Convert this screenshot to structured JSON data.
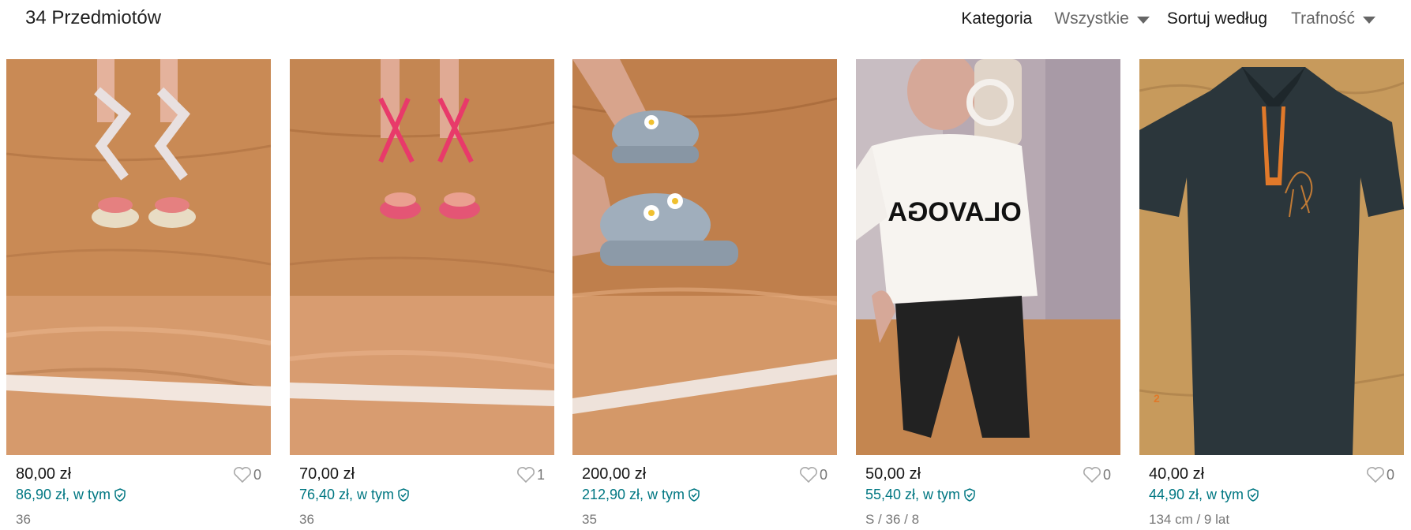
{
  "header": {
    "item_count": "34 Przedmiotów",
    "category_label": "Kategoria",
    "category_value": "Wszystkie",
    "sort_label": "Sortuj według",
    "sort_value": "Trafność"
  },
  "colors": {
    "accent": "#007782",
    "muted": "#777777"
  },
  "items": [
    {
      "price": "80,00 zł",
      "total": "86,90 zł, w tym",
      "favorites": "0",
      "size": "36",
      "photo": "floral wrap wedge sandals on wood floor"
    },
    {
      "price": "70,00 zł",
      "total": "76,40 zł, w tym",
      "favorites": "1",
      "size": "36",
      "photo": "pink strappy heel sandals on wood floor"
    },
    {
      "price": "200,00 zł",
      "total": "212,90 zł, w tym",
      "favorites": "0",
      "size": "35",
      "photo": "grey platform clogs with daisy charms"
    },
    {
      "price": "50,00 zł",
      "total": "55,40 zł, w tym",
      "favorites": "0",
      "size": "S / 36 / 8",
      "photo": "white OLAVOGA t-shirt mirror selfie"
    },
    {
      "price": "40,00 zł",
      "total": "44,90 zł, w tym",
      "favorites": "0",
      "size": "134 cm / 9 lat",
      "photo": "dark polo shirt with orange horse logo"
    }
  ]
}
